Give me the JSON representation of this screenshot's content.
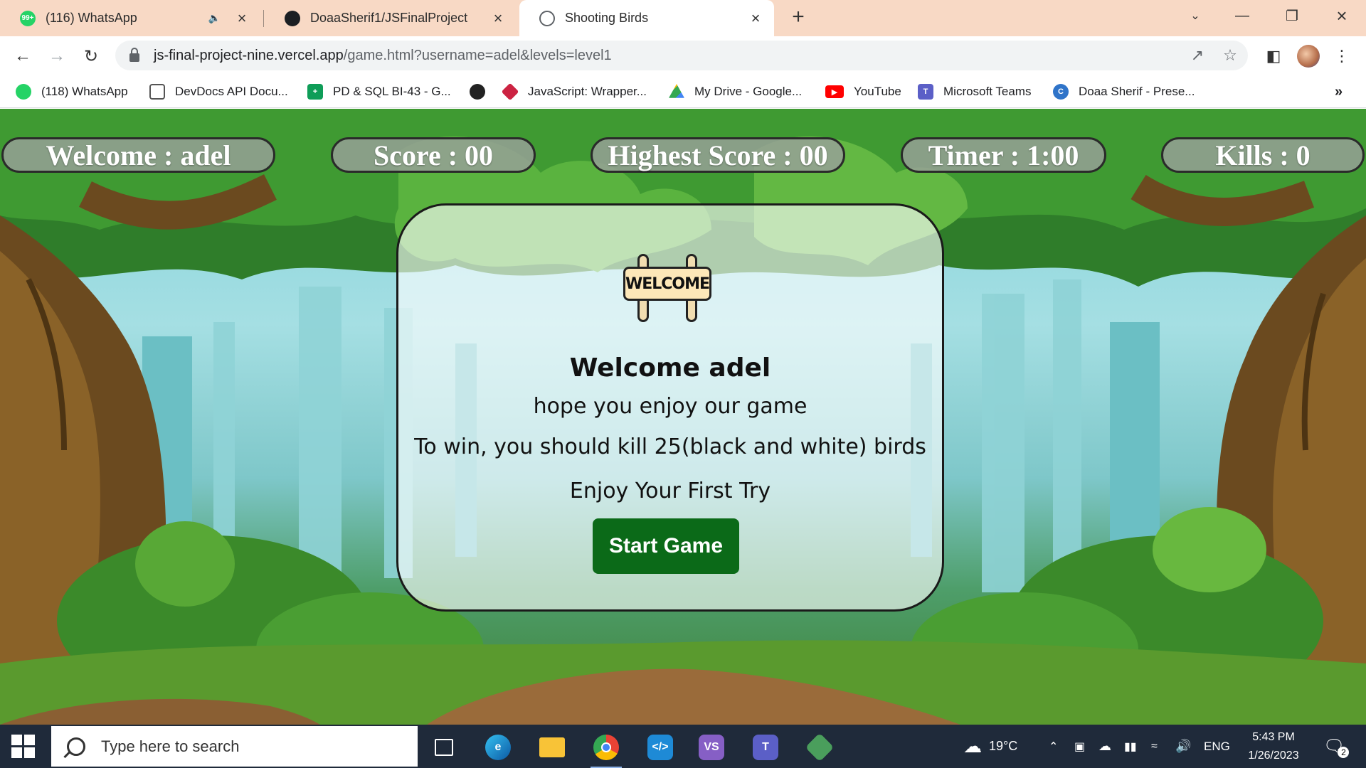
{
  "browser": {
    "tabs": [
      {
        "title": "(116) WhatsApp",
        "icon": "whatsapp-icon",
        "badge": "99+",
        "active": false
      },
      {
        "title": "DoaaSherif1/JSFinalProject",
        "icon": "github-icon",
        "active": false
      },
      {
        "title": "Shooting Birds",
        "icon": "globe-icon",
        "active": true
      }
    ],
    "url_host": "js-final-project-nine.vercel.app",
    "url_path": "/game.html?username=adel&levels=level1",
    "bookmarks": [
      {
        "label": "(118) WhatsApp",
        "icon": "whatsapp-icon"
      },
      {
        "label": "DevDocs API Docu...",
        "icon": "devdocs-icon"
      },
      {
        "label": "PD & SQL BI-43 - G...",
        "icon": "sheets-icon"
      },
      {
        "label": "JavaScript: Wrapper...",
        "icon": "ruby-icon"
      },
      {
        "label": "My Drive - Google...",
        "icon": "drive-icon"
      },
      {
        "label": "YouTube",
        "icon": "youtube-icon"
      },
      {
        "label": "Microsoft Teams",
        "icon": "teams-icon"
      },
      {
        "label": "Doaa Sherif - Prese...",
        "icon": "canva-icon"
      }
    ]
  },
  "hud": {
    "welcome": "Welcome : adel",
    "score": "Score : 00",
    "highest": "Highest Score : 00",
    "timer": "Timer : 1:00",
    "kills": "Kills : 0"
  },
  "panel": {
    "sign_text": "WELCOME",
    "heading": "Welcome adel",
    "line1": "hope you enjoy our game",
    "line2": "To win, you should kill 25(black and white) birds",
    "line3": "Enjoy Your First Try",
    "button": "Start Game"
  },
  "taskbar": {
    "search_placeholder": "Type here to search",
    "weather": "19°C",
    "language": "ENG",
    "time": "5:43 PM",
    "date": "1/26/2023",
    "notifications": "2"
  },
  "colors": {
    "tabbar_bg": "#f8d9c5",
    "start_button": "#0b6a18",
    "taskbar_bg": "#1f2a3a"
  }
}
